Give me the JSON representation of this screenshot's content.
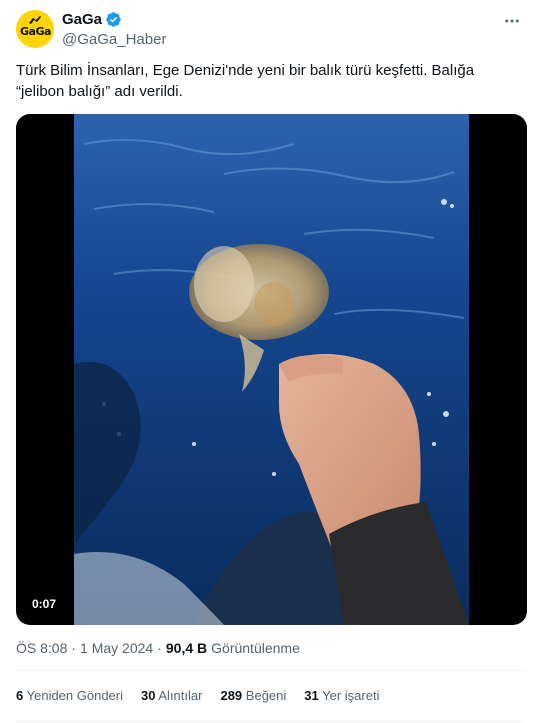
{
  "author": {
    "display_name": "GaGa",
    "handle": "@GaGa_Haber",
    "avatar_text": "GaGa",
    "verified": true,
    "verified_color": "#1d9bf0"
  },
  "tweet": {
    "text": "Türk Bilim İnsanları, Ege Denizi'nde yeni bir balık türü keşfetti. Balığa “jelibon balığı” adı verildi.",
    "video_duration": "0:07"
  },
  "meta": {
    "time": "ÖS 8:08",
    "separator": "·",
    "date": "1 May 2024",
    "views_count": "90,4 B",
    "views_label": "Görüntülenme"
  },
  "stats": {
    "retweets_count": "6",
    "retweets_label": "Yeniden Gönderi",
    "quotes_count": "30",
    "quotes_label": "Alıntılar",
    "likes_count": "289",
    "likes_label": "Beğeni",
    "bookmarks_count": "31",
    "bookmarks_label": "Yer işareti"
  },
  "icons": {
    "more": "more-horizontal-icon",
    "verified": "verified-badge-icon"
  },
  "colors": {
    "text_primary": "#0f1419",
    "text_secondary": "#536471",
    "avatar_bg": "#ffd400",
    "divider": "#eff3f4"
  }
}
